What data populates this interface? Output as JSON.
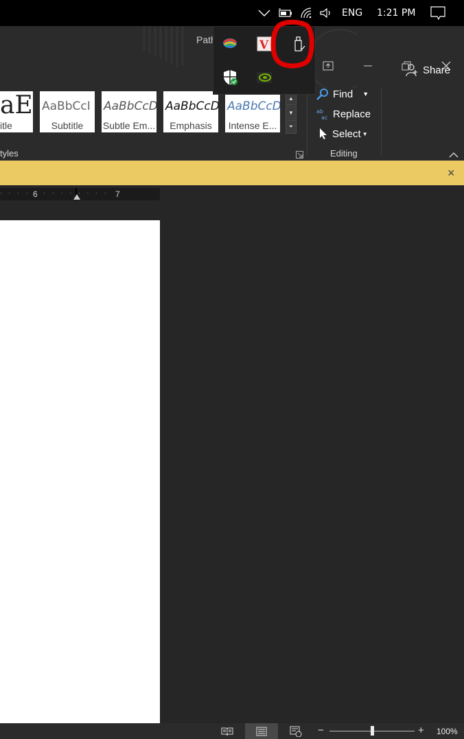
{
  "taskbar": {
    "language": "ENG",
    "time": "1:21 PM"
  },
  "title": {
    "partial_title": "Path"
  },
  "share": {
    "label": "Share"
  },
  "styles": [
    {
      "sample": "aE",
      "name": "itle"
    },
    {
      "sample": "AaBbCcI",
      "name": "Subtitle"
    },
    {
      "sample": "AaBbCcD",
      "name": "Subtle Em..."
    },
    {
      "sample": "AaBbCcD",
      "name": "Emphasis"
    },
    {
      "sample": "AaBbCcD",
      "name": "Intense E..."
    }
  ],
  "groups": {
    "styles_label": "tyles",
    "editing_label": "Editing"
  },
  "editing": {
    "find": "Find",
    "replace": "Replace",
    "select": "Select"
  },
  "ruler": {
    "mark6": "6",
    "mark7": "7"
  },
  "status": {
    "zoom": "100%"
  },
  "message_bar": {
    "close": "×"
  },
  "colors": {
    "highlight_circle": "#e00000",
    "message_bar": "#ecca63"
  }
}
